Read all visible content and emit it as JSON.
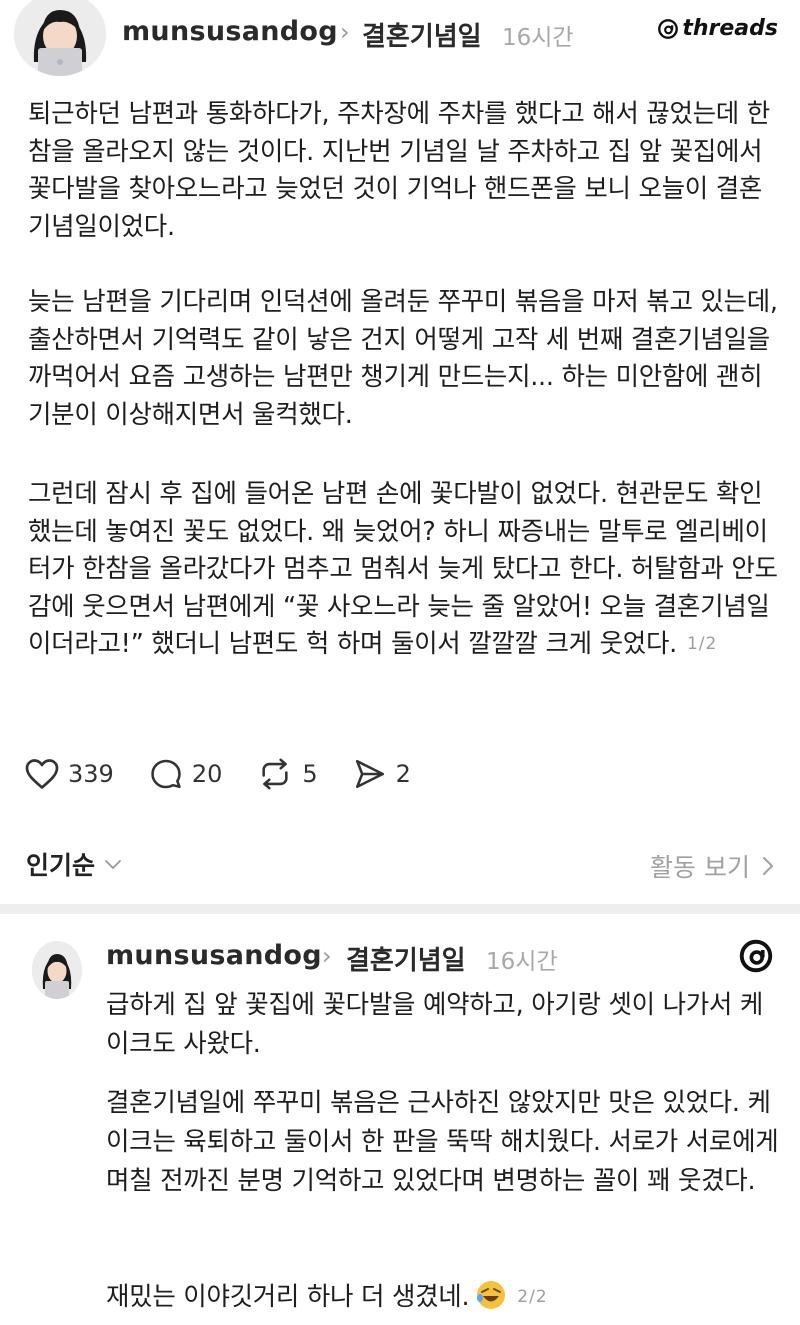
{
  "post1": {
    "username": "munsusandog",
    "topic": "결혼기념일",
    "time": "16시간",
    "brand": "threads",
    "paragraphs": [
      "퇴근하던 남편과 통화하다가, 주차장에 주차를 했다고 해서 끊었는데 한참을 올라오지 않는 것이다. 지난번 기념일 날 주차하고 집 앞 꽃집에서 꽃다발을 찾아오느라고 늦었던 것이 기억나 핸드폰을 보니 오늘이 결혼기념일이었다.",
      "늦는 남편을 기다리며 인덕션에 올려둔 쭈꾸미 볶음을 마저 볶고 있는데, 출산하면서 기억력도 같이 낳은 건지 어떻게 고작 세 번째 결혼기념일을 까먹어서 요즘 고생하는 남편만 챙기게 만드는지... 하는 미안함에 괜히 기분이 이상해지면서 울컥했다.",
      "그런데 잠시 후 집에 들어온 남편 손에 꽃다발이 없었다. 현관문도 확인했는데 놓여진 꽃도 없었다. 왜 늦었어? 하니 짜증내는 말투로 엘리베이터가 한참을 올라갔다가 멈추고 멈춰서 늦게 탔다고 한다. 허탈함과 안도감에 웃으면서 남편에게 “꽃 사오느라 늦는 줄 알았어! 오늘 결혼기념일이더라고!” 했더니 남편도 헉 하며 둘이서 깔깔깔 크게 웃었다."
    ],
    "page_indicator": "1/2",
    "likes": "339",
    "comments": "20",
    "reposts": "5",
    "shares": "2"
  },
  "sort_bar": {
    "sort_label": "인기순",
    "activity_label": "활동 보기"
  },
  "post2": {
    "username": "munsusandog",
    "topic": "결혼기념일",
    "time": "16시간",
    "paragraphs": [
      "급하게 집 앞 꽃집에 꽃다발을 예약하고, 아기랑 셋이 나가서 케이크도 사왔다.",
      "결혼기념일에 쭈꾸미 볶음은 근사하진 않았지만 맛은 있었다. 케이크는 육퇴하고 둘이서 한 판을 뚝딱 해치웠다. 서로가 서로에게 며칠 전까진 분명 기억하고 있었다며 변명하는 꼴이 꽤 웃겼다.",
      "재밌는 이야깃거리 하나 더 생겼네."
    ],
    "emoji": "rolling-laughing-emoji",
    "page_indicator": "2/2"
  },
  "colors": {
    "text": "#1e1e1e",
    "muted": "#a8a8a8",
    "separator": "#eeeeee"
  }
}
